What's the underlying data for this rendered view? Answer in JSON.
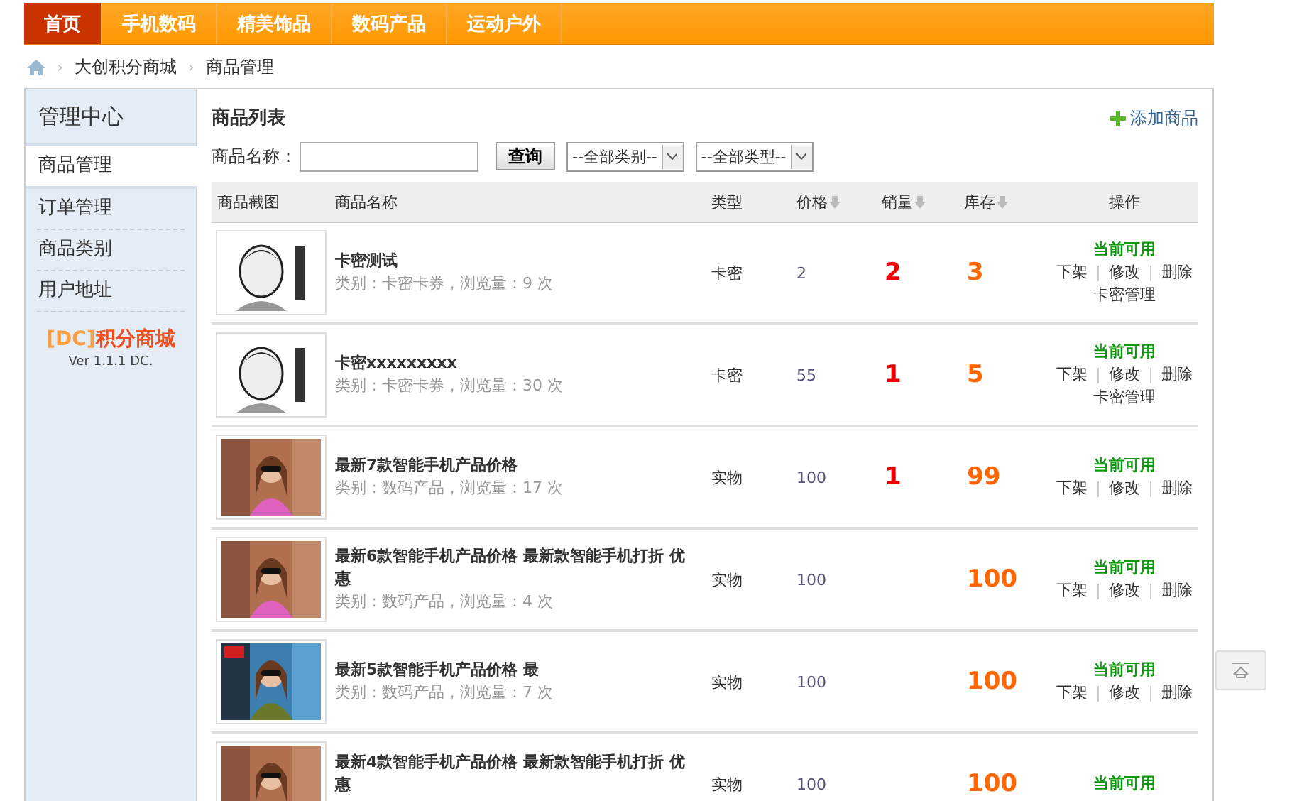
{
  "nav": [
    {
      "label": "首页",
      "selected": true
    },
    {
      "label": "手机数码",
      "selected": false
    },
    {
      "label": "精美饰品",
      "selected": false
    },
    {
      "label": "数码产品",
      "selected": false
    },
    {
      "label": "运动户外",
      "selected": false
    }
  ],
  "breadcrumb": [
    {
      "separator": "›",
      "label": "大创积分商城"
    },
    {
      "separator": "›",
      "label": "商品管理"
    }
  ],
  "sidebar": {
    "title": "管理中心",
    "items": [
      {
        "label": "商品管理",
        "selected": true
      },
      {
        "label": "订单管理",
        "selected": false
      },
      {
        "label": "商品类别",
        "selected": false
      },
      {
        "label": "用户地址",
        "selected": false
      }
    ],
    "brand_prefix": "[DC]",
    "brand_name": "积分商城",
    "version": "Ver 1.1.1 DC."
  },
  "content": {
    "title": "商品列表",
    "add_link": "添加商品",
    "search_label": "商品名称：",
    "search_button": "查询",
    "filters": [
      "--全部类别--",
      "--全部类型--"
    ]
  },
  "table": {
    "columns": [
      {
        "label": "商品截图",
        "sortable": false
      },
      {
        "label": "商品名称",
        "sortable": false
      },
      {
        "label": "类型",
        "sortable": false
      },
      {
        "label": "价格",
        "sortable": true
      },
      {
        "label": "销量",
        "sortable": true
      },
      {
        "label": "库存",
        "sortable": true
      },
      {
        "label": "操作",
        "sortable": false
      }
    ],
    "rows": [
      {
        "thumb": {
          "kind": "picture"
        },
        "name": "卡密测试",
        "meta": "类别：卡密卡券，浏览量：9 次",
        "type": "卡密",
        "price": "2",
        "sales": "2",
        "stock": "3",
        "status": "当前可用",
        "actions": [
          "下架",
          "修改",
          "删除"
        ],
        "extra_action": "卡密管理"
      },
      {
        "thumb": {
          "kind": "picture"
        },
        "name": "卡密xxxxxxxxx",
        "meta": "类别：卡密卡券，浏览量：30 次",
        "type": "卡密",
        "price": "55",
        "sales": "1",
        "stock": "5",
        "status": "当前可用",
        "actions": [
          "下架",
          "修改",
          "删除"
        ],
        "extra_action": "卡密管理"
      },
      {
        "thumb": {
          "kind": "picture"
        },
        "name": "最新7款智能手机产品价格",
        "meta": "类别：数码产品，浏览量：17 次",
        "type": "实物",
        "price": "100",
        "sales": "1",
        "stock": "99",
        "status": "当前可用",
        "actions": [
          "下架",
          "修改",
          "删除"
        ]
      },
      {
        "thumb": {
          "kind": "picture"
        },
        "name": "最新6款智能手机产品价格 最新款智能手机打折 优惠",
        "meta": "类别：数码产品，浏览量：4 次",
        "type": "实物",
        "price": "100",
        "stock": "100",
        "status": "当前可用",
        "actions": [
          "下架",
          "修改",
          "删除"
        ]
      },
      {
        "thumb": {
          "kind": "picture"
        },
        "name": "最新5款智能手机产品价格 最",
        "meta": "类别：数码产品，浏览量：7 次",
        "type": "实物",
        "price": "100",
        "stock": "100",
        "status": "当前可用",
        "actions": [
          "下架",
          "修改",
          "删除"
        ]
      },
      {
        "thumb": {
          "kind": "picture"
        },
        "name": "最新4款智能手机产品价格 最新款智能手机打折 优惠",
        "type": "实物",
        "price": "100",
        "stock": "100",
        "status": "当前可用"
      }
    ]
  }
}
